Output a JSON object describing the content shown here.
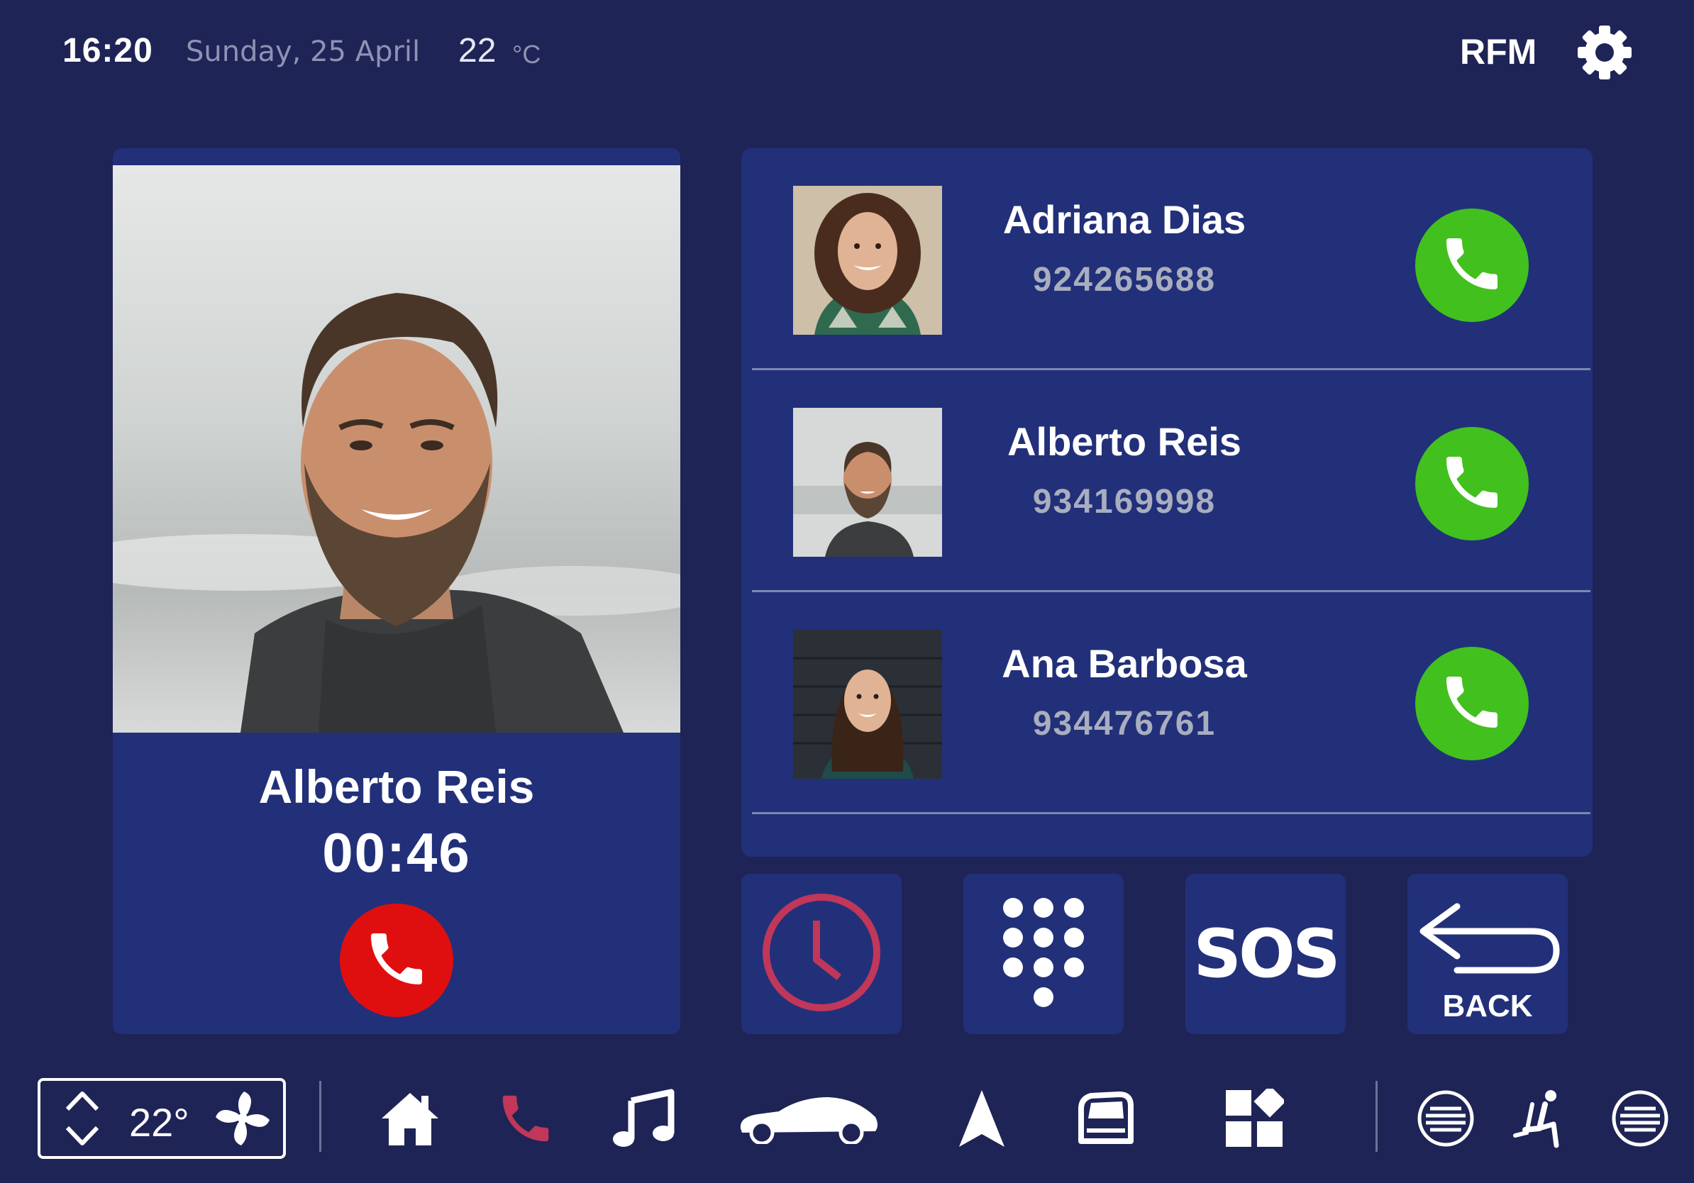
{
  "status_bar": {
    "time": "16:20",
    "date": "Sunday, 25 April",
    "temperature": "22",
    "temperature_unit": "°C",
    "radio": "RFM",
    "settings_icon": "gear-icon"
  },
  "active_call": {
    "name": "Alberto Reis",
    "duration": "00:46",
    "hangup_icon": "phone-icon",
    "hangup_color": "#e00f0f"
  },
  "contacts": [
    {
      "name": "Adriana Dias",
      "number": "924265688"
    },
    {
      "name": "Alberto Reis",
      "number": "934169998"
    },
    {
      "name": "Ana Barbosa",
      "number": "934476761"
    }
  ],
  "quick_actions": {
    "history_icon": "clock-icon",
    "keypad_icon": "keypad-icon",
    "sos_label": "SOS",
    "back_label": "BACK"
  },
  "dock": {
    "climate_temperature": "22°",
    "items": [
      "home-icon",
      "phone-icon",
      "music-icon",
      "car-icon",
      "navigation-icon",
      "vehicle-window-icon",
      "apps-icon",
      "seat-heat-left-icon",
      "seat-icon",
      "seat-heat-right-icon"
    ],
    "active_item": "phone-icon"
  },
  "colors": {
    "background": "#1f2456",
    "panel": "#22307a",
    "call_green": "#42c01e",
    "hangup_red": "#e00f0f",
    "accent_pink": "#c0375a"
  }
}
